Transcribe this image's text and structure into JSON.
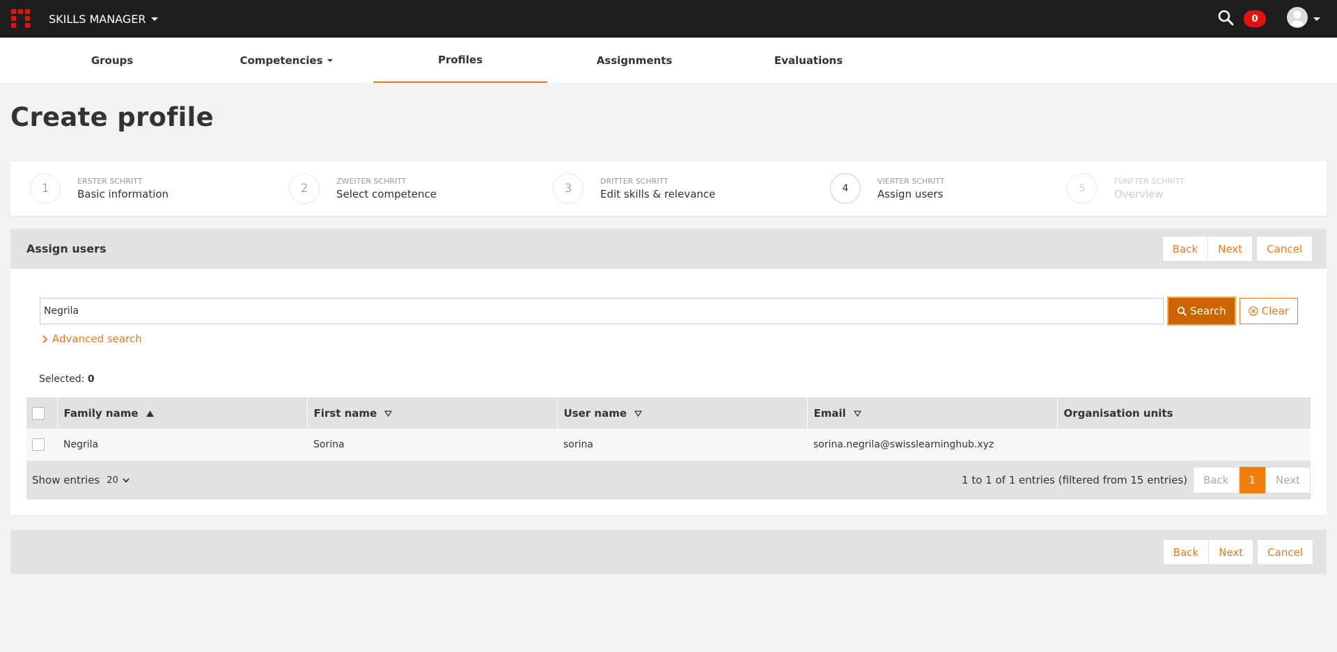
{
  "app": {
    "name": "SKILLS MANAGER",
    "notifications_count": "0",
    "colors": {
      "accent": "#e8791d",
      "brand_red": "#e3120b",
      "topbar": "#1e1e1e"
    }
  },
  "nav": {
    "groups": "Groups",
    "competencies": "Competencies",
    "profiles": "Profiles",
    "assignments": "Assignments",
    "evaluations": "Evaluations",
    "active": "Profiles"
  },
  "page": {
    "title": "Create profile"
  },
  "steps": [
    {
      "number": "1",
      "small": "ERSTER SCHRITT",
      "label": "Basic information",
      "state": "done"
    },
    {
      "number": "2",
      "small": "ZWEITER SCHRITT",
      "label": "Select competence",
      "state": "done"
    },
    {
      "number": "3",
      "small": "DRITTER SCHRITT",
      "label": "Edit skills & relevance",
      "state": "done"
    },
    {
      "number": "4",
      "small": "VIERTER SCHRITT",
      "label": "Assign users",
      "state": "current"
    },
    {
      "number": "5",
      "small": "FÜNFTER SCHRITT",
      "label": "Overview",
      "state": "disabled"
    }
  ],
  "panel": {
    "title": "Assign users",
    "back": "Back",
    "next": "Next",
    "cancel": "Cancel"
  },
  "search": {
    "value": "Negrila",
    "search_label": "Search",
    "clear_label": "Clear",
    "advanced_label": "Advanced search"
  },
  "selection": {
    "label": "Selected:",
    "count": "0"
  },
  "table": {
    "columns": {
      "family_name": "Family name",
      "first_name": "First name",
      "user_name": "User name",
      "email": "Email",
      "org_units": "Organisation units"
    },
    "rows": [
      {
        "family_name": "Negrila",
        "first_name": "Sorina",
        "user_name": "sorina",
        "email": "sorina.negrila@swisslearninghub.xyz",
        "org_units": ""
      }
    ]
  },
  "table_footer": {
    "show_entries": "Show entries",
    "page_size": "20",
    "info": "1 to 1 of 1 entries (filtered from 15 entries)",
    "back": "Back",
    "page": "1",
    "next": "Next"
  }
}
